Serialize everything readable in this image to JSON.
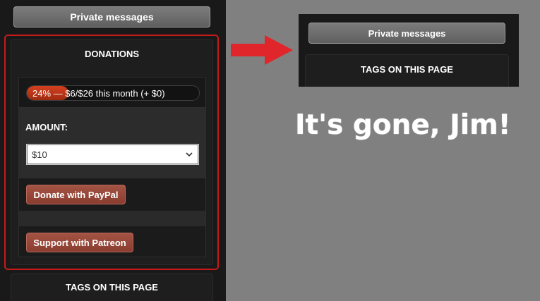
{
  "colors": {
    "background": "#808080",
    "sidebar": "#191919",
    "highlight_border": "#c41a1a",
    "arrow": "#e0262b",
    "progress_fill": "#c23a1b",
    "donate_button": "#9a4a3b"
  },
  "before": {
    "private_messages": "Private messages",
    "donations": {
      "title": "DONATIONS",
      "progress": {
        "percent_label": "24% —",
        "amount_text": "$6/$26 this month (+ $0)",
        "fraction": 0.24
      },
      "amount_label": "AMOUNT:",
      "amount_value": "$10",
      "paypal_button": "Donate with PayPal",
      "patreon_button": "Support with Patreon"
    },
    "tags_title": "TAGS ON THIS PAGE"
  },
  "after": {
    "private_messages": "Private messages",
    "tags_title": "TAGS ON THIS PAGE"
  },
  "caption": "It's gone, Jim!",
  "icons": {
    "arrow": "right-arrow-icon",
    "select": "chevron-down-icon"
  }
}
